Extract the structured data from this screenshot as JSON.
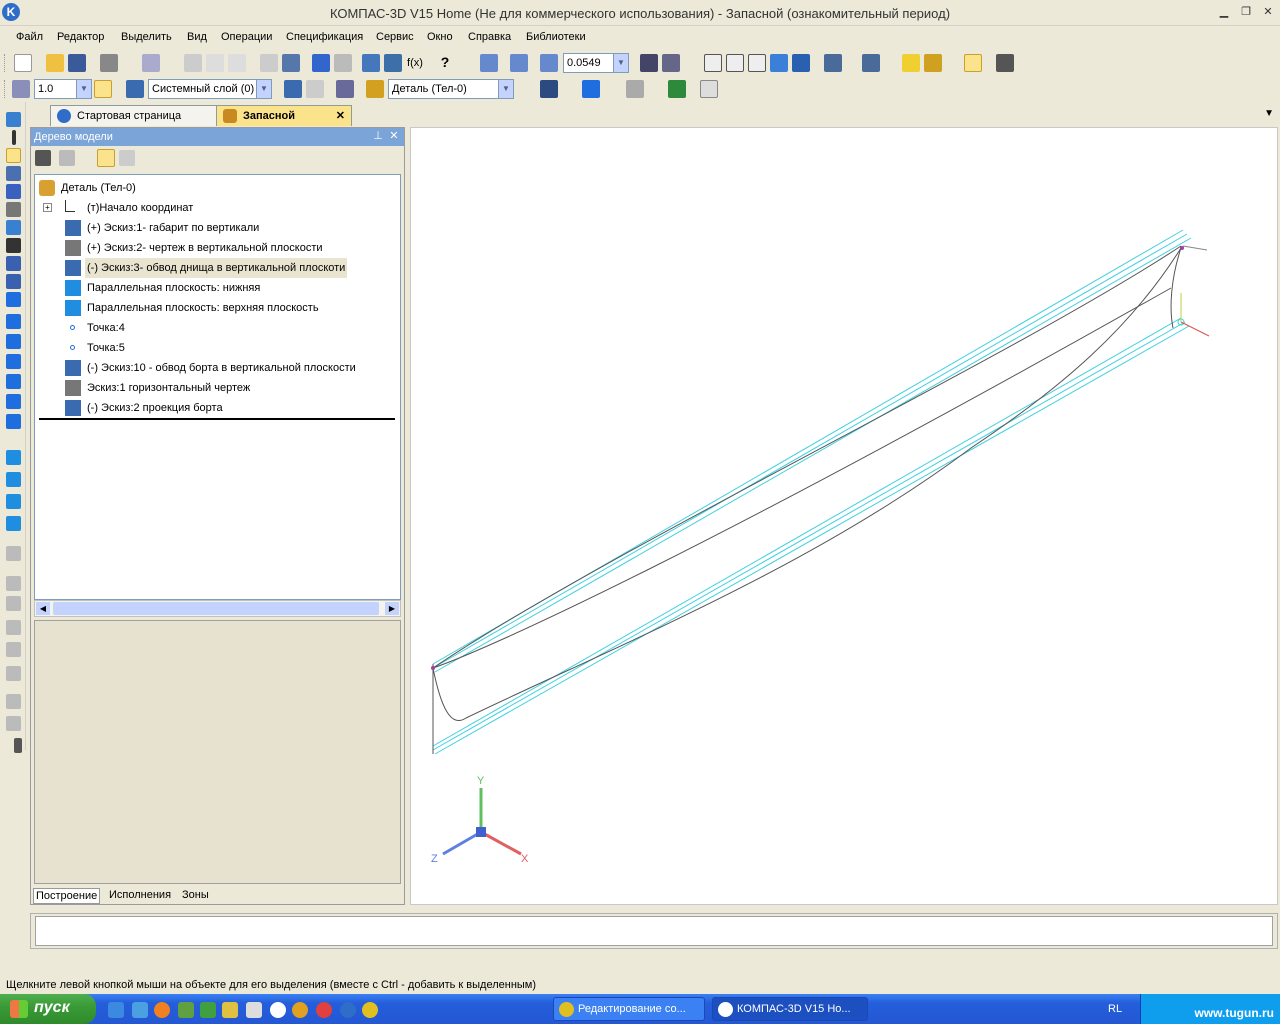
{
  "window": {
    "title": "КОМПАС-3D V15 Home (Не для коммерческого использования) - Запасной (ознакомительный период)"
  },
  "menu": [
    "Файл",
    "Редактор",
    "Выделить",
    "Вид",
    "Операции",
    "Спецификация",
    "Сервис",
    "Окно",
    "Справка",
    "Библиотеки"
  ],
  "toolbar": {
    "zoom_value": "0.0549",
    "step_value": "1.0",
    "layer_value": "Системный слой (0)",
    "detail_value": "Деталь (Тел-0)"
  },
  "tabs": [
    {
      "label": "Стартовая страница"
    },
    {
      "label": "Запасной"
    }
  ],
  "panel": {
    "title": "Дерево модели"
  },
  "tree": {
    "root": "Деталь (Тел-0)",
    "items": [
      "(т)Начало координат",
      "(+) Эскиз:1- габарит по вертикали",
      "(+) Эскиз:2- чертеж в вертикальной плоскости",
      "(-) Эскиз:3- обвод днища в вертикальной плоскоти",
      "Параллельная плоскость: нижняя",
      "Параллельная плоскость: верхняя плоскость",
      "Точка:4",
      "Точка:5",
      "(-) Эскиз:10 - обвод борта в вертикальной плоскости",
      "Эскиз:1 горизонтальный чертеж",
      "(-) Эскиз:2 проекция борта"
    ]
  },
  "bottom_tabs": [
    "Построение",
    "Исполнения",
    "Зоны"
  ],
  "axes": {
    "x": "X",
    "y": "Y",
    "z": "Z"
  },
  "status": "Щелкните левой кнопкой мыши на объекте для его выделения (вместе с Ctrl - добавить к выделенным)",
  "taskbar": {
    "start": "пуск",
    "tasks": [
      "Редактирование со...",
      "КОМПАС-3D V15 Но..."
    ],
    "lang": "RL",
    "watermark": "www.tugun.ru"
  },
  "colors": {
    "accent_tab": "#fbe38c",
    "cyan_line": "#40d0e0",
    "panel_header": "#7ba4d8"
  }
}
